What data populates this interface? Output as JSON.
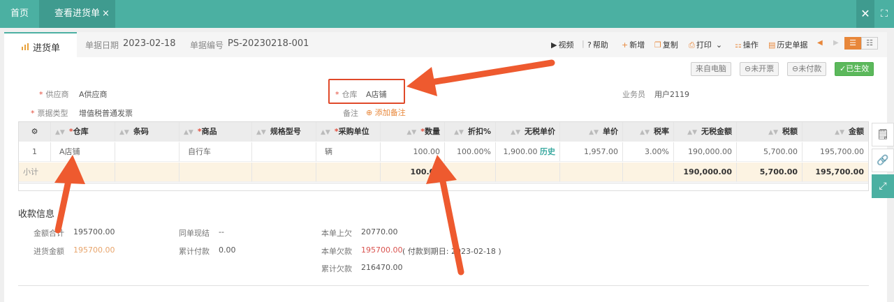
{
  "topbar": {
    "home_tab": "首页",
    "active_tab": "查看进货单",
    "close_glyph": "×",
    "close_window_glyph": "✕",
    "fullscreen_glyph": "⛶"
  },
  "doc": {
    "tab_label": "进货单",
    "date_label": "单据日期",
    "date_value": "2023-02-18",
    "number_label": "单据编号",
    "number_value": "PS-20230218-001"
  },
  "toolbar": {
    "video": "视频",
    "help": "帮助",
    "add": "新增",
    "copy": "复制",
    "print": "打印",
    "operate": "操作",
    "history": "历史单据"
  },
  "status_badges": {
    "source": "来自电脑",
    "invoice": "未开票",
    "payment": "未付款",
    "effective": "已生效"
  },
  "form": {
    "supplier_label": "供应商",
    "supplier_value": "A供应商",
    "warehouse_label": "仓库",
    "warehouse_value": "A店铺",
    "salesman_label": "业务员",
    "salesman_value": "用户2119",
    "invoice_type_label": "票据类型",
    "invoice_type_value": "增值税普通发票",
    "remark_label": "备注",
    "add_remark": "添加备注"
  },
  "table": {
    "headers": {
      "warehouse": "仓库",
      "barcode": "条码",
      "product": "商品",
      "spec": "规格型号",
      "unit": "采购单位",
      "qty": "数量",
      "discount": "折扣%",
      "price_ex_tax": "无税单价",
      "price": "单价",
      "tax_rate": "税率",
      "amount_ex_tax": "无税金额",
      "tax": "税额",
      "amount": "金额"
    },
    "row": {
      "index": "1",
      "warehouse": "A店铺",
      "barcode": "",
      "product": "自行车",
      "spec": "",
      "unit": "辆",
      "qty": "100.00",
      "discount": "100.00%",
      "price_ex_tax": "1,900.00",
      "history_link": "历史",
      "price": "1,957.00",
      "tax_rate": "3.00%",
      "amount_ex_tax": "190,000.00",
      "tax": "5,700.00",
      "amount": "195,700.00"
    },
    "subtotal": {
      "label": "小计",
      "qty": "100.00",
      "amount_ex_tax": "190,000.00",
      "tax": "5,700.00",
      "amount": "195,700.00"
    }
  },
  "payment": {
    "title": "收款信息",
    "total_label": "金额合计",
    "total_value": "195700.00",
    "purchase_label": "进货金额",
    "purchase_value": "195700.00",
    "same_bill_label": "同单现结",
    "same_bill_value": "--",
    "cum_paid_label": "累计付款",
    "cum_paid_value": "0.00",
    "prev_owed_label": "本单上欠",
    "prev_owed_value": "20770.00",
    "owed_label": "本单欠款",
    "owed_value": "195700.00",
    "owed_note": "( 付款到期日: 2023-02-18 )",
    "cum_owed_label": "累计欠款",
    "cum_owed_value": "216470.00"
  },
  "colors": {
    "brand": "#4bb0a2",
    "accent_orange": "#e8873a",
    "required_red": "#e34d3c",
    "annotation_red": "#e0492a"
  }
}
